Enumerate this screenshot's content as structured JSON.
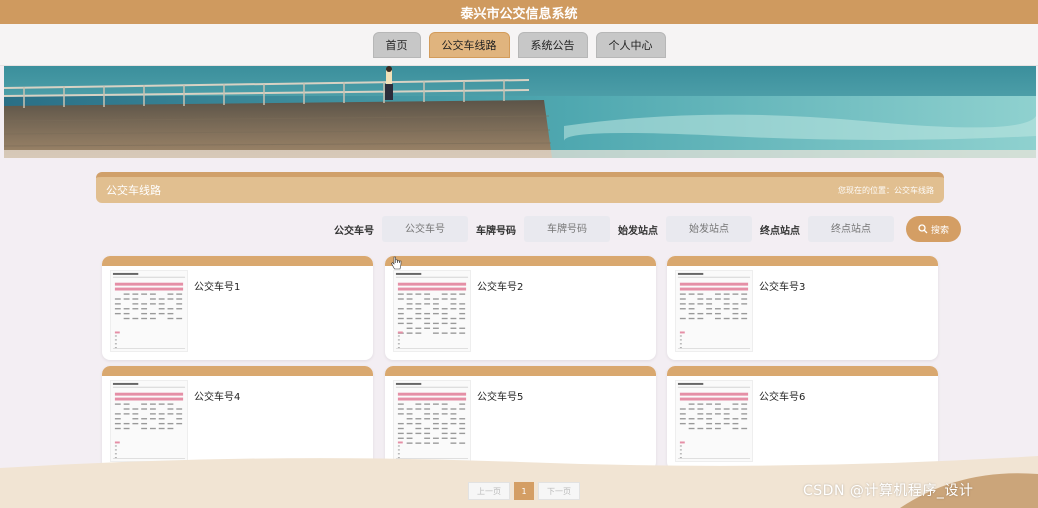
{
  "app": {
    "title": "泰兴市公交信息系统"
  },
  "nav": {
    "items": [
      {
        "label": "首页",
        "active": false
      },
      {
        "label": "公交车线路",
        "active": true
      },
      {
        "label": "系统公告",
        "active": false
      },
      {
        "label": "个人中心",
        "active": false
      }
    ]
  },
  "section": {
    "title": "公交车线路",
    "breadcrumb": "您现在的位置：公交车线路"
  },
  "search": {
    "fields": [
      {
        "label": "公交车号",
        "placeholder": "公交车号"
      },
      {
        "label": "车牌号码",
        "placeholder": "车牌号码"
      },
      {
        "label": "始发站点",
        "placeholder": "始发站点"
      },
      {
        "label": "终点站点",
        "placeholder": "终点站点"
      }
    ],
    "button_label": "搜索"
  },
  "cards": [
    {
      "label": "公交车号1"
    },
    {
      "label": "公交车号2"
    },
    {
      "label": "公交车号3"
    },
    {
      "label": "公交车号4"
    },
    {
      "label": "公交车号5"
    },
    {
      "label": "公交车号6"
    }
  ],
  "pagination": {
    "prev_label": "上一页",
    "current_page": "1",
    "next_label": "下一页"
  },
  "watermark": "CSDN @计算机程序_设计",
  "colors": {
    "brand": "#cf9a5f",
    "accent": "#d49e64",
    "header_bar": "#e1bf90"
  },
  "icons": {
    "search_button": "magnifier-icon"
  }
}
